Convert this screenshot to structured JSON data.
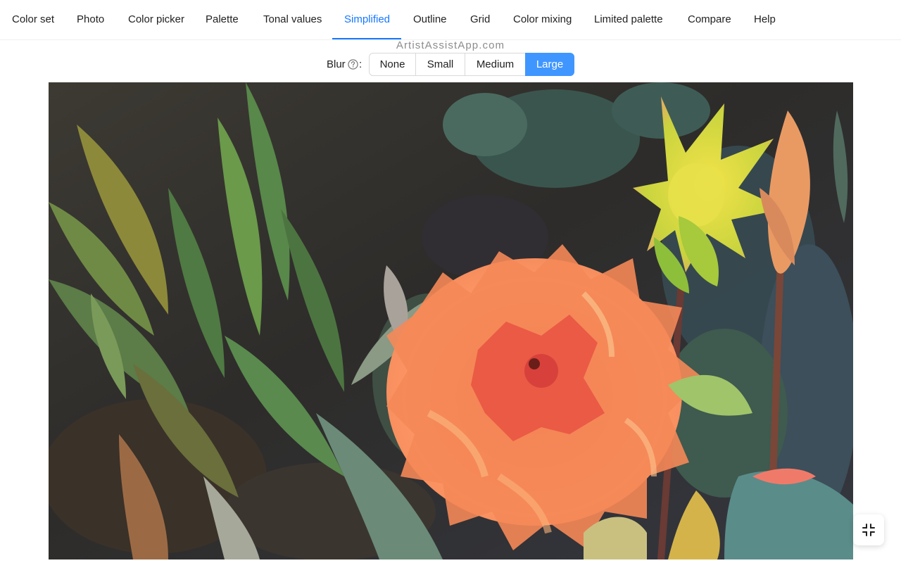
{
  "tabs": [
    {
      "label": "Color set",
      "name": "tab-color-set"
    },
    {
      "label": "Photo",
      "name": "tab-photo"
    },
    {
      "label": "Color picker",
      "name": "tab-color-picker"
    },
    {
      "label": "Palette",
      "name": "tab-palette"
    },
    {
      "label": "Tonal values",
      "name": "tab-tonal-values"
    },
    {
      "label": "Simplified",
      "name": "tab-simplified",
      "active": true
    },
    {
      "label": "Outline",
      "name": "tab-outline"
    },
    {
      "label": "Grid",
      "name": "tab-grid"
    },
    {
      "label": "Color mixing",
      "name": "tab-color-mixing"
    },
    {
      "label": "Limited palette",
      "name": "tab-limited-palette"
    },
    {
      "label": "Compare",
      "name": "tab-compare"
    },
    {
      "label": "Help",
      "name": "tab-help"
    }
  ],
  "watermark": "ArtistAssistApp.com",
  "blur": {
    "label": "Blur",
    "colon": ":",
    "help_icon": "question-circle-icon",
    "options": [
      "None",
      "Small",
      "Medium",
      "Large"
    ],
    "selected": "Large"
  },
  "photo": {
    "subject": "simplified-orange-dahlia-photo"
  },
  "fullscreen": {
    "icon": "fullscreen-exit-icon"
  },
  "colors": {
    "accent": "#1677ff",
    "selected_segment": "#4096ff",
    "watermark": "#8c8c8c"
  }
}
